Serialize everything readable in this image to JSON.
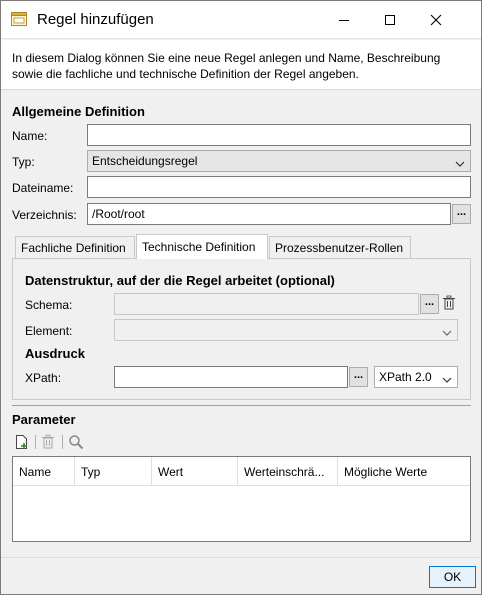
{
  "window": {
    "title": "Regel hinzufügen",
    "description": "In diesem Dialog können Sie eine neue Regel anlegen und Name, Beschreibung sowie die fachliche und technische Definition der Regel angeben."
  },
  "general": {
    "heading": "Allgemeine Definition",
    "name_label": "Name:",
    "name_value": "",
    "type_label": "Typ:",
    "type_value": "Entscheidungsregel",
    "filename_label": "Dateiname:",
    "filename_value": "",
    "directory_label": "Verzeichnis:",
    "directory_value": "/Root/root",
    "browse_label": "..."
  },
  "tabs": [
    {
      "label": "Fachliche Definition",
      "active": false
    },
    {
      "label": "Technische Definition",
      "active": true
    },
    {
      "label": "Prozessbenutzer-Rollen",
      "active": false
    }
  ],
  "technical": {
    "structure_heading": "Datenstruktur, auf der die Regel arbeitet (optional)",
    "schema_label": "Schema:",
    "schema_value": "",
    "schema_browse": "...",
    "element_label": "Element:",
    "element_value": "",
    "expression_heading": "Ausdruck",
    "xpath_label": "XPath:",
    "xpath_value": "",
    "xpath_browse": "...",
    "xpath_version": "XPath 2.0"
  },
  "parameters": {
    "heading": "Parameter",
    "columns": [
      "Name",
      "Typ",
      "Wert",
      "Werteinschrä...",
      "Mögliche Werte"
    ],
    "rows": []
  },
  "footer": {
    "ok_label": "OK"
  },
  "icons": {
    "app": "dialog-window-icon",
    "minimize": "minimize-icon",
    "maximize": "maximize-icon",
    "close": "close-icon",
    "add": "add-parameter-icon",
    "delete": "trash-icon",
    "search": "search-icon",
    "dropdown": "chevron-down-icon"
  }
}
